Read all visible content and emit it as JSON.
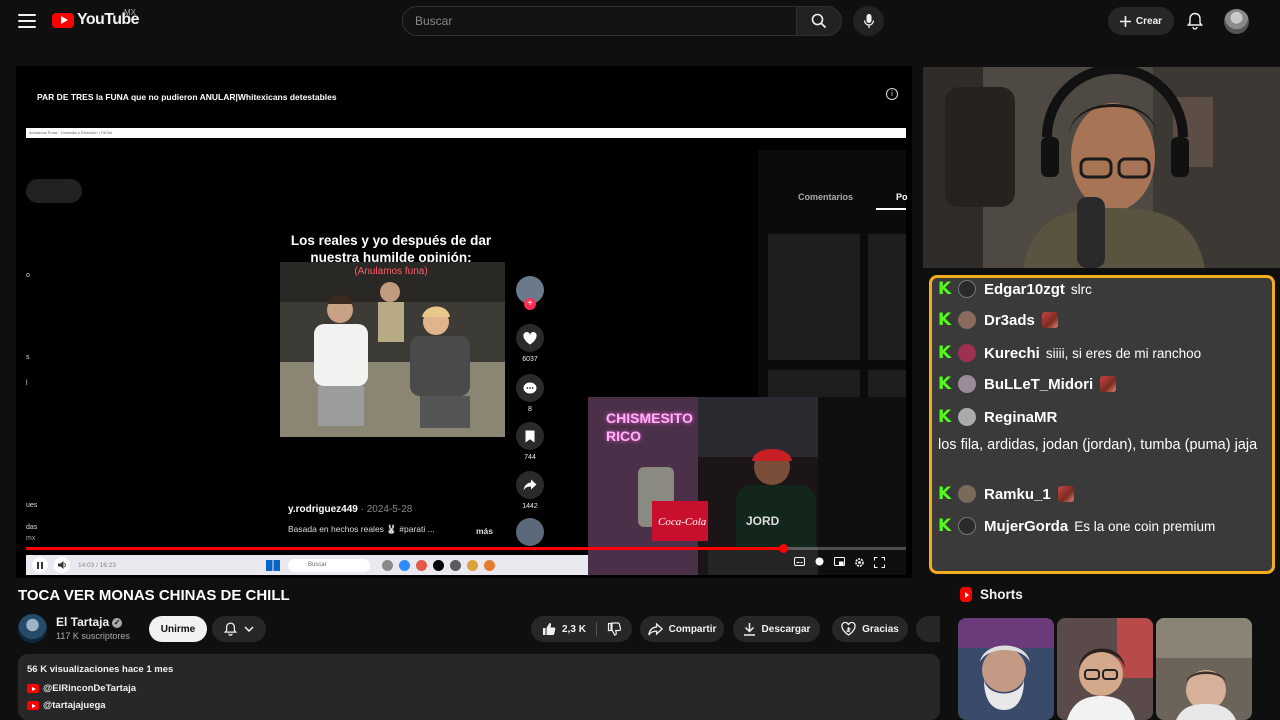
{
  "header": {
    "logo_text": "YouTube",
    "country": "MX",
    "search_placeholder": "Buscar",
    "create_label": "Crear"
  },
  "player": {
    "video_title": "PAR DE TRES la FUNA que no pudieron ANULAR|Whitexicans detestables",
    "info_symbol": "i",
    "tab_text": "Anulamos Funa · Comedia y Diversión | TikTok",
    "sidebar_tabs": [
      "Comentarios",
      "Po"
    ],
    "left_glyphs": [
      "o",
      "s",
      "l",
      "ues",
      "das",
      "mx"
    ],
    "caption_line1": "Los reales y yo después de dar nuestra humilde opinión:",
    "caption_line2": "(Anulamos funa)",
    "actions": [
      {
        "icon": "heart-icon",
        "count": "6037"
      },
      {
        "icon": "comment-icon",
        "count": "8"
      },
      {
        "icon": "bookmark-icon",
        "count": "744"
      },
      {
        "icon": "share-icon",
        "count": "1442"
      }
    ],
    "author": "y.rodriguez449",
    "date": "· 2024-5-28",
    "description": "Basada en hechos reales 🐰 #parati ...",
    "more_label": "más",
    "overlay_text": "CHISMESITO RICO",
    "time": "14:03 / 16:23",
    "taskbar_search": "Buscar",
    "progress": 0.86
  },
  "chat": {
    "border_color": "#f4ac1c",
    "badge_color": "#53fc18",
    "messages": [
      {
        "user": "Edgar10zgt",
        "text": "slrc",
        "emote": false
      },
      {
        "user": "Dr3ads",
        "text": "",
        "emote": true
      },
      {
        "user": "Kurechi",
        "text": "siiii, si eres de mi ranchoo",
        "emote": false
      },
      {
        "user": "BuLLeT_Midori",
        "text": "",
        "emote": true
      },
      {
        "user": "ReginaMR",
        "text": "",
        "emote": false
      },
      {
        "user": "",
        "text": "los fila, ardidas, jodan (jordan), tumba (puma) jaja",
        "emote": false
      },
      {
        "user": "Ramku_1",
        "text": "",
        "emote": true
      },
      {
        "user": "MujerGorda",
        "text": "Es la one coin premium",
        "emote": false
      }
    ]
  },
  "video": {
    "title": "TOCA VER MONAS CHINAS DE CHILL",
    "channel": "El Tartaja",
    "subscribers": "117 K suscriptores",
    "join_label": "Unirme",
    "likes": "2,3 K",
    "share_label": "Compartir",
    "download_label": "Descargar",
    "thanks_label": "Gracias",
    "stats": "56 K visualizaciones  hace 1 mes",
    "links": [
      "@ElRinconDeTartaja",
      "@tartajajuega"
    ]
  },
  "shorts": {
    "title": "Shorts"
  }
}
